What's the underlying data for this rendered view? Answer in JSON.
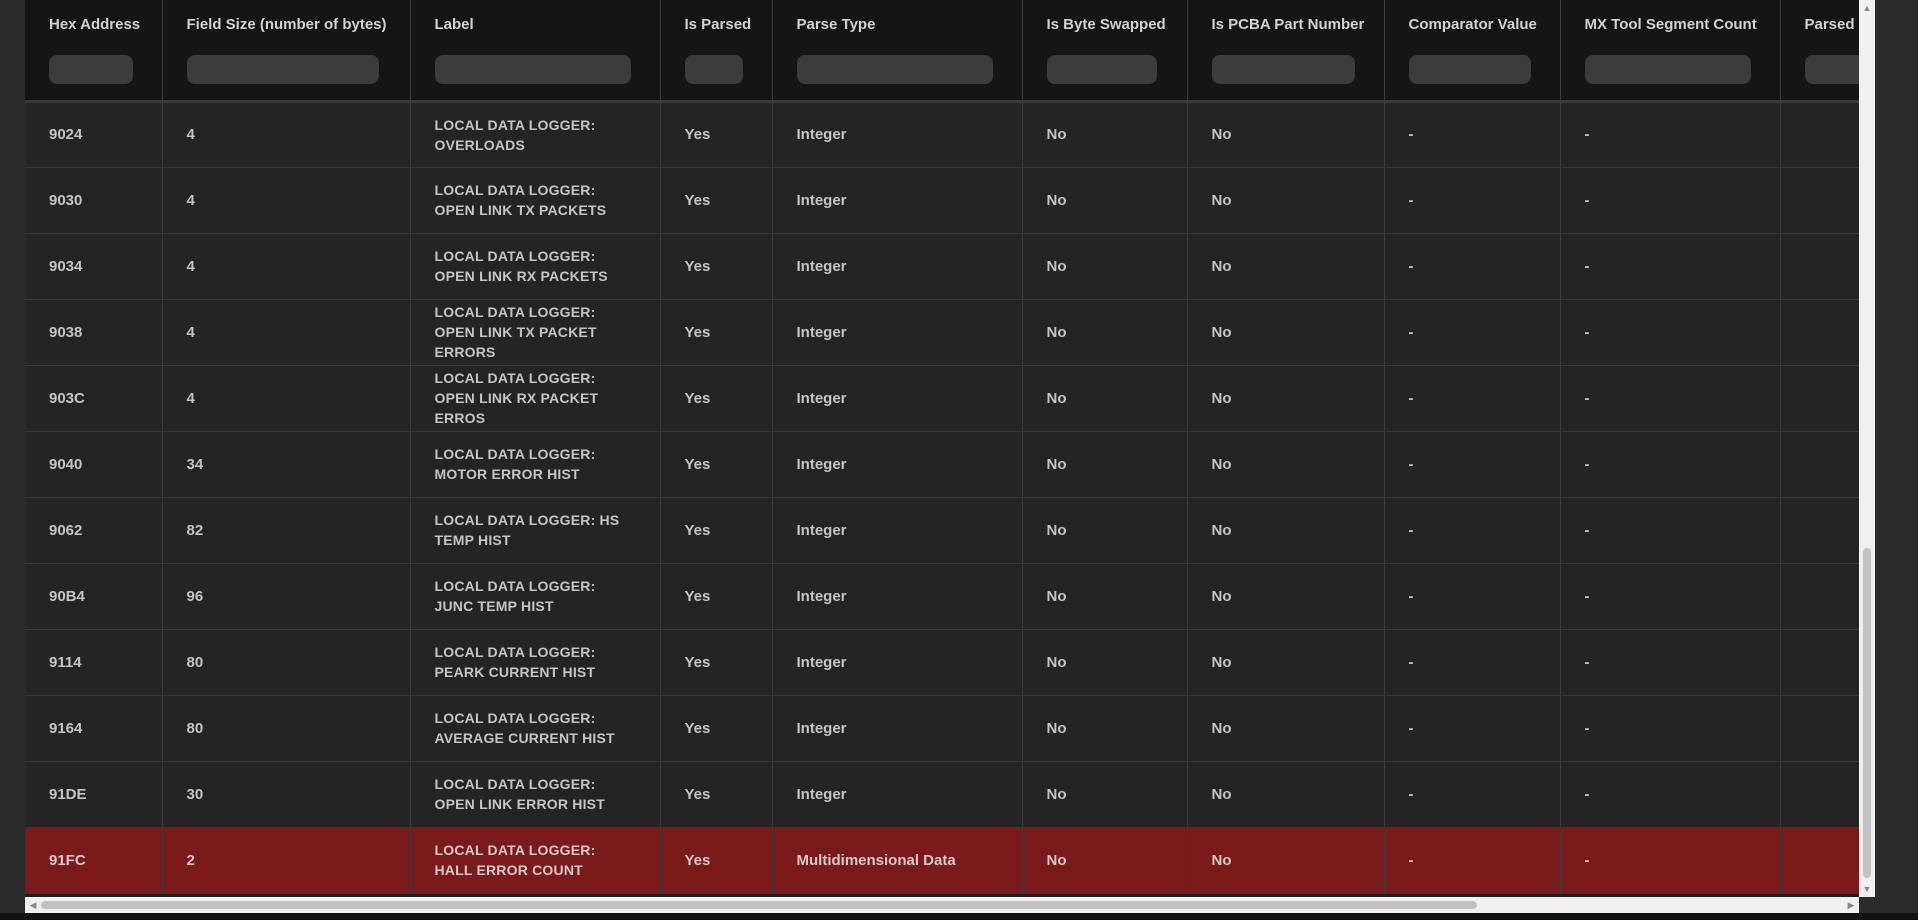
{
  "grid": {
    "columns": [
      {
        "label": "Hex Address",
        "width": 137,
        "filter_width": 80
      },
      {
        "label": "Field Size (number of bytes)",
        "width": 248,
        "filter_width": 188
      },
      {
        "label": "Label",
        "width": 250,
        "filter_width": 192
      },
      {
        "label": "Is Parsed",
        "width": 112,
        "filter_width": 54
      },
      {
        "label": "Parse Type",
        "width": 250,
        "filter_width": 192
      },
      {
        "label": "Is Byte Swapped",
        "width": 165,
        "filter_width": 106
      },
      {
        "label": "Is PCBA Part Number",
        "width": 197,
        "filter_width": 139
      },
      {
        "label": "Comparator Value",
        "width": 176,
        "filter_width": 118
      },
      {
        "label": "MX Tool Segment Count",
        "width": 220,
        "filter_width": 162
      },
      {
        "label": "Parsed C",
        "width": 245,
        "filter_width": 180
      }
    ],
    "rows": [
      {
        "hex": "9024",
        "size": "4",
        "label": "LOCAL DATA LOGGER: OVERLOADS",
        "parsed": "Yes",
        "type": "Integer",
        "swapped": "No",
        "pcba": "No",
        "comparator": "-",
        "segments": "-",
        "parsed_c": ""
      },
      {
        "hex": "9030",
        "size": "4",
        "label": "LOCAL DATA LOGGER: OPEN LINK TX PACKETS",
        "parsed": "Yes",
        "type": "Integer",
        "swapped": "No",
        "pcba": "No",
        "comparator": "-",
        "segments": "-",
        "parsed_c": ""
      },
      {
        "hex": "9034",
        "size": "4",
        "label": "LOCAL DATA LOGGER: OPEN LINK RX PACKETS",
        "parsed": "Yes",
        "type": "Integer",
        "swapped": "No",
        "pcba": "No",
        "comparator": "-",
        "segments": "-",
        "parsed_c": ""
      },
      {
        "hex": "9038",
        "size": "4",
        "label": "LOCAL DATA LOGGER: OPEN LINK TX PACKET ERRORS",
        "parsed": "Yes",
        "type": "Integer",
        "swapped": "No",
        "pcba": "No",
        "comparator": "-",
        "segments": "-",
        "parsed_c": ""
      },
      {
        "hex": "903C",
        "size": "4",
        "label": "LOCAL DATA LOGGER: OPEN LINK RX PACKET ERROS",
        "parsed": "Yes",
        "type": "Integer",
        "swapped": "No",
        "pcba": "No",
        "comparator": "-",
        "segments": "-",
        "parsed_c": ""
      },
      {
        "hex": "9040",
        "size": "34",
        "label": "LOCAL DATA LOGGER: MOTOR ERROR HIST",
        "parsed": "Yes",
        "type": "Integer",
        "swapped": "No",
        "pcba": "No",
        "comparator": "-",
        "segments": "-",
        "parsed_c": ""
      },
      {
        "hex": "9062",
        "size": "82",
        "label": "LOCAL DATA LOGGER: HS TEMP HIST",
        "parsed": "Yes",
        "type": "Integer",
        "swapped": "No",
        "pcba": "No",
        "comparator": "-",
        "segments": "-",
        "parsed_c": ""
      },
      {
        "hex": "90B4",
        "size": "96",
        "label": "LOCAL DATA LOGGER: JUNC TEMP HIST",
        "parsed": "Yes",
        "type": "Integer",
        "swapped": "No",
        "pcba": "No",
        "comparator": "-",
        "segments": "-",
        "parsed_c": ""
      },
      {
        "hex": "9114",
        "size": "80",
        "label": "LOCAL DATA LOGGER: PEARK CURRENT HIST",
        "parsed": "Yes",
        "type": "Integer",
        "swapped": "No",
        "pcba": "No",
        "comparator": "-",
        "segments": "-",
        "parsed_c": ""
      },
      {
        "hex": "9164",
        "size": "80",
        "label": "LOCAL DATA LOGGER: AVERAGE CURRENT HIST",
        "parsed": "Yes",
        "type": "Integer",
        "swapped": "No",
        "pcba": "No",
        "comparator": "-",
        "segments": "-",
        "parsed_c": ""
      },
      {
        "hex": "91DE",
        "size": "30",
        "label": "LOCAL DATA LOGGER: OPEN LINK ERROR HIST",
        "parsed": "Yes",
        "type": "Integer",
        "swapped": "No",
        "pcba": "No",
        "comparator": "-",
        "segments": "-",
        "parsed_c": ""
      },
      {
        "hex": "91FC",
        "size": "2",
        "label": "LOCAL DATA LOGGER: HALL ERROR COUNT",
        "parsed": "Yes",
        "type": "Multidimensional Data",
        "swapped": "No",
        "pcba": "No",
        "comparator": "-",
        "segments": "-",
        "parsed_c": "",
        "selected": true
      }
    ]
  },
  "colors": {
    "header_bg": "#151515",
    "row_bg": "#242424",
    "selected_row_bg": "#7b1a1a",
    "border": "#3c3c3c"
  },
  "scrollbars": {
    "left_arrow_icon": "◀",
    "right_arrow_icon": "▶",
    "up_arrow_icon": "▲",
    "down_arrow_icon": "▼"
  }
}
